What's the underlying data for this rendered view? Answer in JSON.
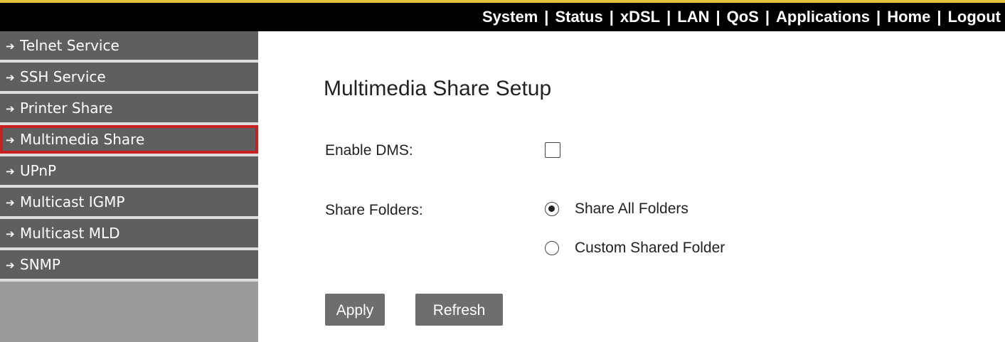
{
  "top_nav": {
    "items": [
      "System",
      "Status",
      "xDSL",
      "LAN",
      "QoS",
      "Applications",
      "Home",
      "Logout"
    ],
    "separator": "|"
  },
  "sidebar": {
    "arrow_glyph": "➔",
    "items": [
      {
        "label": "Telnet Service",
        "active": false
      },
      {
        "label": "SSH Service",
        "active": false
      },
      {
        "label": "Printer Share",
        "active": false
      },
      {
        "label": "Multimedia Share",
        "active": true
      },
      {
        "label": "UPnP",
        "active": false
      },
      {
        "label": "Multicast IGMP",
        "active": false
      },
      {
        "label": "Multicast MLD",
        "active": false
      },
      {
        "label": "SNMP",
        "active": false
      }
    ]
  },
  "main": {
    "title": "Multimedia Share Setup",
    "enable_dms": {
      "label": "Enable DMS:",
      "checked": false
    },
    "share_folders": {
      "label": "Share Folders:",
      "options": [
        {
          "label": "Share All Folders",
          "selected": true
        },
        {
          "label": "Custom Shared Folder",
          "selected": false
        }
      ]
    },
    "buttons": {
      "apply": "Apply",
      "refresh": "Refresh"
    }
  },
  "colors": {
    "topbar_bg": "#000000",
    "topbar_accent": "#e8c13a",
    "sidebar_item_bg": "#5f5f5f",
    "sidebar_bg": "#dcdcdc",
    "active_highlight": "#c8201f",
    "button_bg": "#6e6e6e"
  }
}
